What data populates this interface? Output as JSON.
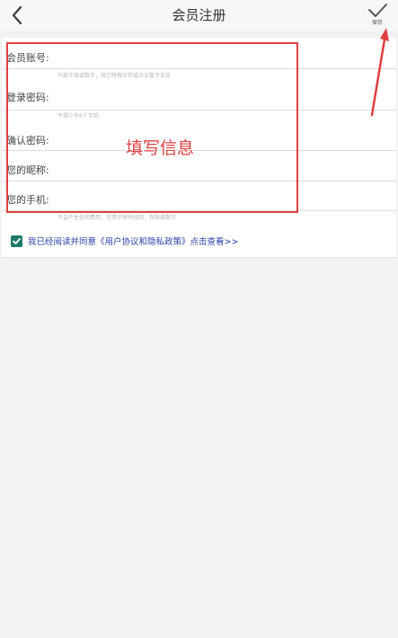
{
  "header": {
    "title": "会员注册",
    "save_label": "保存"
  },
  "form": {
    "fields": [
      {
        "label": "会员账号:",
        "hint": "只能字母或数字，其它特殊字符或中文暂不支持"
      },
      {
        "label": "登录密码:",
        "hint": "不得少于6个字符"
      },
      {
        "label": "确认密码:",
        "hint": ""
      },
      {
        "label": "您的昵称:",
        "hint": ""
      },
      {
        "label": "您的手机:",
        "hint": "不会产生任何费用，可用于密码找回，仅限填数字"
      }
    ]
  },
  "annotation": {
    "text": "填写信息",
    "color": "#e04040"
  },
  "agreement": {
    "checked": true,
    "text": "我已经阅读并同意《用户协议和隐私政策》点击查看>>"
  },
  "colors": {
    "accent": "#1f7a6a",
    "link": "#2b3ea8"
  }
}
